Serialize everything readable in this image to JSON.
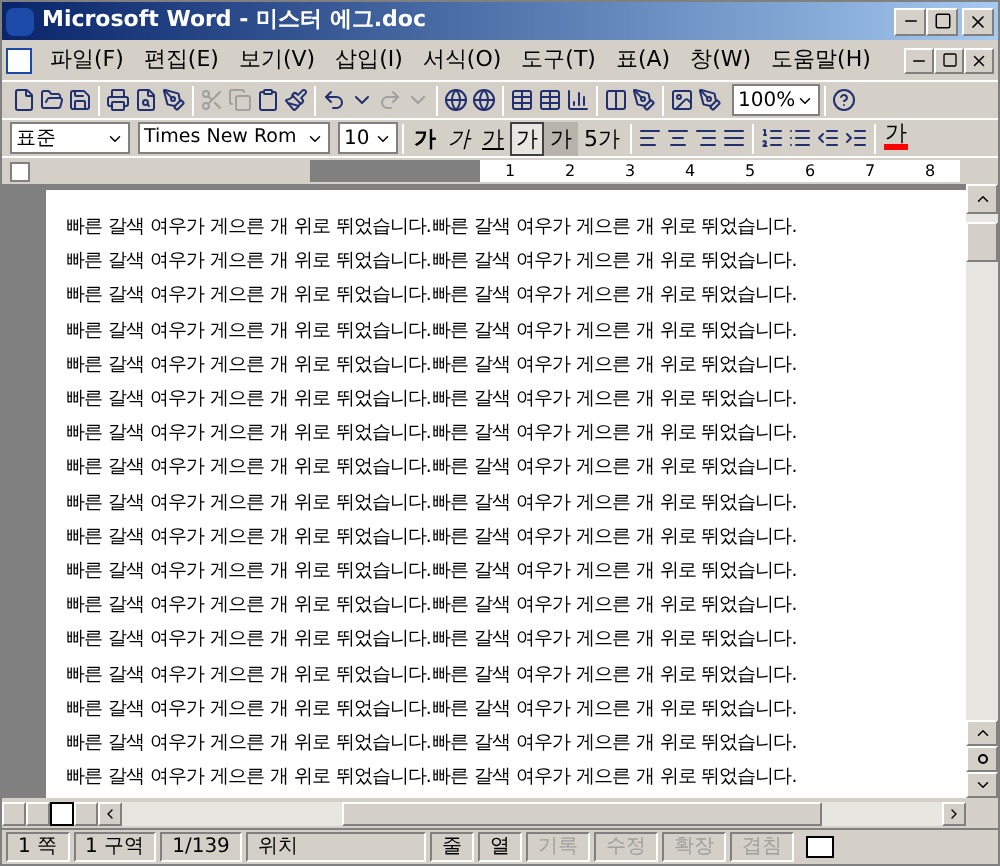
{
  "window": {
    "title": "Microsoft Word - 미스터 에그.doc"
  },
  "menu": [
    "파일(F)",
    "편집(E)",
    "보기(V)",
    "삽입(I)",
    "서식(O)",
    "도구(T)",
    "표(A)",
    "창(W)",
    "도움말(H)"
  ],
  "toolbar": {
    "zoom": "100%"
  },
  "formatting": {
    "style": "표준",
    "font": "Times New Rom",
    "size": "10",
    "text_buttons": [
      {
        "label": "가",
        "kind": "bold",
        "selected": false
      },
      {
        "label": "가",
        "kind": "italic",
        "selected": false
      },
      {
        "label": "가",
        "kind": "underline",
        "selected": false
      },
      {
        "label": "가",
        "kind": "boxed",
        "selected": true
      },
      {
        "label": "가",
        "kind": "shaded",
        "selected": false
      },
      {
        "label": "5가",
        "kind": "plain",
        "selected": false
      }
    ],
    "font_color": {
      "label": "가",
      "color": "#ff0000"
    }
  },
  "ruler": {
    "labels": [
      "1",
      "2",
      "3",
      "4",
      "5",
      "6",
      "7",
      "8"
    ]
  },
  "document": {
    "lines": [
      "빠른 갈색 여우가 게으른 개 위로 뛰었습니다.빠른 갈색 여우가 게으른 개 위로 뛰었습니다.",
      "빠른 갈색 여우가 게으른 개 위로 뛰었습니다.빠른 갈색 여우가 게으른 개 위로 뛰었습니다.",
      "빠른 갈색 여우가 게으른 개 위로 뛰었습니다.빠른 갈색 여우가 게으른 개 위로 뛰었습니다.",
      "빠른 갈색 여우가 게으른 개 위로 뛰었습니다.빠른 갈색 여우가 게으른 개 위로 뛰었습니다.",
      "빠른 갈색 여우가 게으른 개 위로 뛰었습니다.빠른 갈색 여우가 게으른 개 위로 뛰었습니다.",
      "빠른 갈색 여우가 게으른 개 위로 뛰었습니다.빠른 갈색 여우가 게으른 개 위로 뛰었습니다.",
      "빠른 갈색 여우가 게으른 개 위로 뛰었습니다.빠른 갈색 여우가 게으른 개 위로 뛰었습니다.",
      "빠른 갈색 여우가 게으른 개 위로 뛰었습니다.빠른 갈색 여우가 게으른 개 위로 뛰었습니다.",
      "빠른 갈색 여우가 게으른 개 위로 뛰었습니다.빠른 갈색 여우가 게으른 개 위로 뛰었습니다.",
      "빠른 갈색 여우가 게으른 개 위로 뛰었습니다.빠른 갈색 여우가 게으른 개 위로 뛰었습니다.",
      "빠른 갈색 여우가 게으른 개 위로 뛰었습니다.빠른 갈색 여우가 게으른 개 위로 뛰었습니다.",
      "빠른 갈색 여우가 게으른 개 위로 뛰었습니다.빠른 갈색 여우가 게으른 개 위로 뛰었습니다.",
      "빠른 갈색 여우가 게으른 개 위로 뛰었습니다.빠른 갈색 여우가 게으른 개 위로 뛰었습니다.",
      "빠른 갈색 여우가 게으른 개 위로 뛰었습니다.빠른 갈색 여우가 게으른 개 위로 뛰었습니다.",
      "빠른 갈색 여우가 게으른 개 위로 뛰었습니다.빠른 갈색 여우가 게으른 개 위로 뛰었습니다.",
      "빠른 갈색 여우가 게으른 개 위로 뛰었습니다.빠른 갈색 여우가 게으른 개 위로 뛰었습니다.",
      "빠른 갈색 여우가 게으른 개 위로 뛰었습니다.빠른 갈색 여우가 게으른 개 위로 뛰었습니다."
    ]
  },
  "status_bar": [
    {
      "text": "1 쪽",
      "disabled": false
    },
    {
      "text": "1 구역",
      "disabled": false
    },
    {
      "text": "1/139",
      "disabled": false
    },
    {
      "text": "위치",
      "disabled": false
    },
    {
      "text": "줄",
      "disabled": false
    },
    {
      "text": "열",
      "disabled": false
    },
    {
      "text": "기록",
      "disabled": true
    },
    {
      "text": "수정",
      "disabled": true
    },
    {
      "text": "확장",
      "disabled": true
    },
    {
      "text": "겹침",
      "disabled": true
    }
  ]
}
